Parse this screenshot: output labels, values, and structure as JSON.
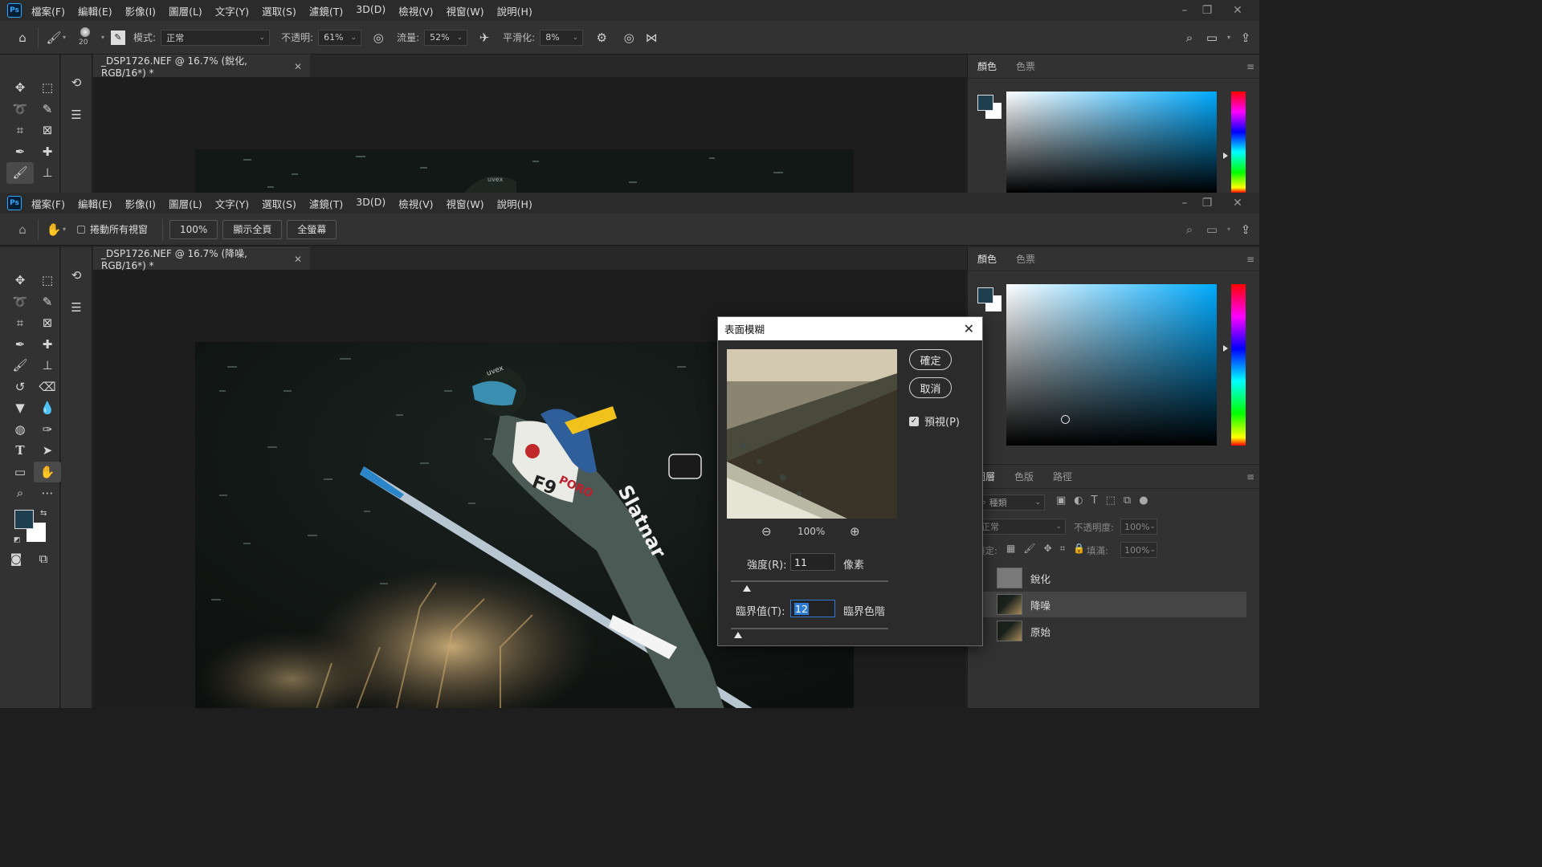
{
  "menu": [
    "檔案(F)",
    "編輯(E)",
    "影像(I)",
    "圖層(L)",
    "文字(Y)",
    "選取(S)",
    "濾鏡(T)",
    "3D(D)",
    "檢視(V)",
    "視窗(W)",
    "說明(H)"
  ],
  "top_window": {
    "options": {
      "brush_size": "20",
      "mode_label": "模式:",
      "mode_value": "正常",
      "opacity_label": "不透明:",
      "opacity_value": "61%",
      "flow_label": "流量:",
      "flow_value": "52%",
      "smoothing_label": "平滑化:",
      "smoothing_value": "8%"
    },
    "doc_tab": "_DSP1726.NEF @ 16.7% (銳化, RGB/16*) *"
  },
  "bottom_window": {
    "options": {
      "scroll_all_label": "捲動所有視窗",
      "zoom_button": "100%",
      "fit_screen_button": "顯示全頁",
      "fill_screen_button": "全螢幕"
    },
    "doc_tab": "_DSP1726.NEF @ 16.7% (降噪, RGB/16*) *"
  },
  "color_panel": {
    "tabs": [
      "顏色",
      "色票"
    ],
    "fg_color": "#1e3f4f",
    "bg_color": "#ffffff"
  },
  "layers_panel": {
    "tabs": [
      "圖層",
      "色版",
      "路徑"
    ],
    "filter_label": "種類",
    "blend_mode": "正常",
    "opacity_label": "不透明度:",
    "opacity_value": "100%",
    "lock_label": "鎖定:",
    "fill_label": "填滿:",
    "fill_value": "100%",
    "layers": [
      {
        "name": "銳化",
        "selected": false
      },
      {
        "name": "降噪",
        "selected": true
      },
      {
        "name": "原始",
        "selected": false
      }
    ]
  },
  "dialog": {
    "title": "表面模糊",
    "ok": "確定",
    "cancel": "取消",
    "preview_label": "預視(P)",
    "preview_checked": true,
    "zoom": "100%",
    "radius_label": "強度(R):",
    "radius_value": "11",
    "radius_unit": "像素",
    "threshold_label": "臨界值(T):",
    "threshold_value": "12",
    "threshold_unit": "臨界色階"
  },
  "canvas_text": {
    "bib": "F9",
    "sponsor": "PORO",
    "suit_brand": "Slatnar",
    "helmet": "uvex"
  }
}
